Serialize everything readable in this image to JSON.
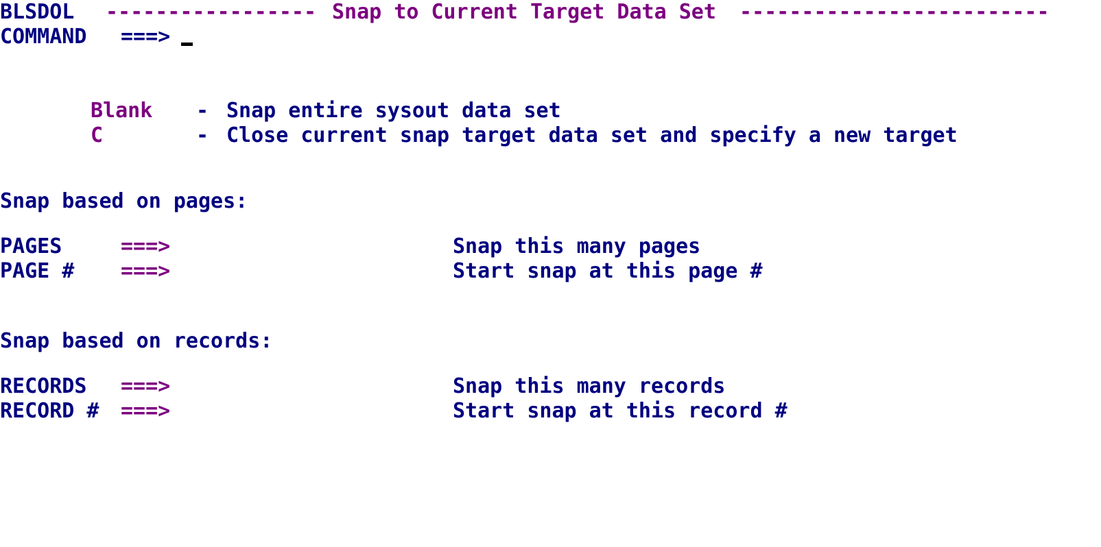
{
  "screen": {
    "panel_id": "BLSDOL",
    "title": "Snap to Current Target Data Set",
    "title_rule_left": "-----------------",
    "title_rule_right": "-------------------------",
    "colors": {
      "normal_text": "#000080",
      "highlight_text": "#7d0080",
      "background": "#ffffff",
      "cursor": "#000000"
    }
  },
  "command_line": {
    "label": "COMMAND",
    "arrow": "===>",
    "value": "",
    "cursor_visible": true
  },
  "options": [
    {
      "key": "Blank",
      "separator": "-",
      "description": "Snap entire sysout data set"
    },
    {
      "key": "C",
      "separator": "-",
      "description": "Close current snap target data set and specify a new target"
    }
  ],
  "sections": [
    {
      "heading": "Snap based on pages:",
      "fields": [
        {
          "label": "PAGES",
          "arrow": "===>",
          "value": "",
          "description": "Snap this many pages"
        },
        {
          "label": "PAGE #",
          "arrow": "===>",
          "value": "",
          "description": "Start snap at this page #"
        }
      ]
    },
    {
      "heading": "Snap based on records:",
      "fields": [
        {
          "label": "RECORDS",
          "arrow": "===>",
          "value": "",
          "description": "Snap this many records"
        },
        {
          "label": "RECORD #",
          "arrow": "===>",
          "value": "",
          "description": "Start snap at this record #"
        }
      ]
    }
  ]
}
